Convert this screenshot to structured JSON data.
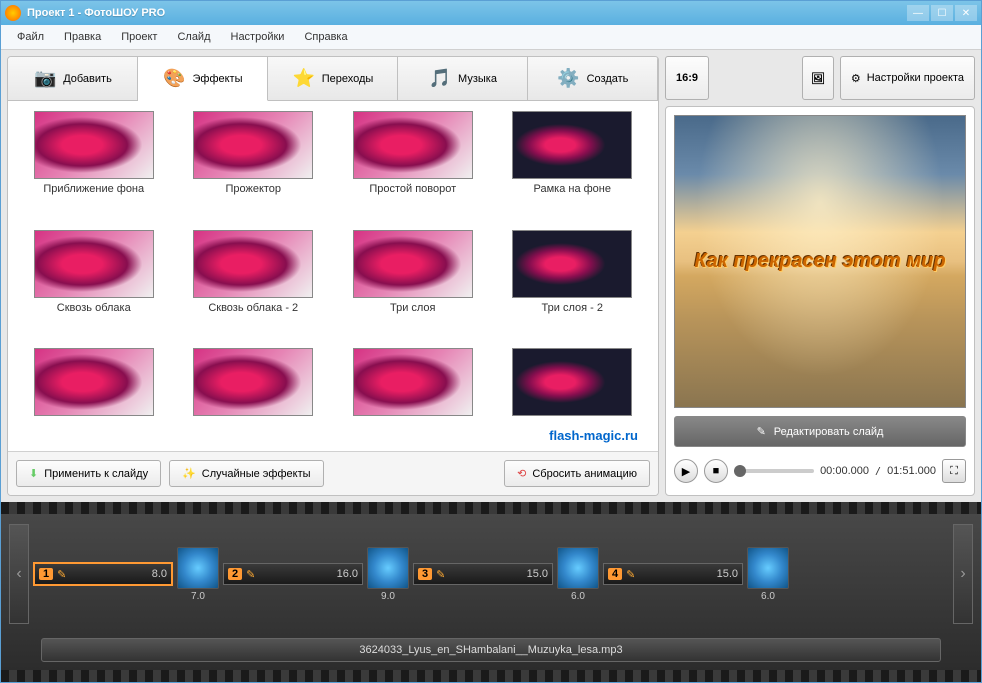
{
  "window": {
    "title": "Проект 1 - ФотоШОУ PRO"
  },
  "menubar": [
    "Файл",
    "Правка",
    "Проект",
    "Слайд",
    "Настройки",
    "Справка"
  ],
  "tabs": {
    "add": "Добавить",
    "effects": "Эффекты",
    "transitions": "Переходы",
    "music": "Музыка",
    "create": "Создать"
  },
  "effects": [
    "Приближение фона",
    "Прожектор",
    "Простой поворот",
    "Рамка на фоне",
    "Сквозь облака",
    "Сквозь облака - 2",
    "Три слоя",
    "Три слоя - 2"
  ],
  "watermark": "flash-magic.ru",
  "actions": {
    "apply": "Применить к слайду",
    "random": "Случайные эффекты",
    "reset": "Сбросить анимацию"
  },
  "right": {
    "ratio": "16:9",
    "settings": "Настройки проекта",
    "preview_text": "Как  прекрасен этот мир",
    "edit_slide": "Редактировать слайд",
    "time_current": "00:00.000",
    "time_total": "01:51.000"
  },
  "timeline": {
    "slides": [
      {
        "num": "1",
        "dur": "8.0",
        "trans": "7.0",
        "kind": "clouds"
      },
      {
        "num": "2",
        "dur": "16.0",
        "trans": "9.0",
        "kind": "sunset"
      },
      {
        "num": "3",
        "dur": "15.0",
        "trans": "6.0",
        "kind": "field"
      },
      {
        "num": "4",
        "dur": "15.0",
        "trans": "6.0",
        "kind": "field"
      }
    ],
    "audio": "3624033_Lyus_en_SHambalani__Muzuyka_lesa.mp3"
  }
}
